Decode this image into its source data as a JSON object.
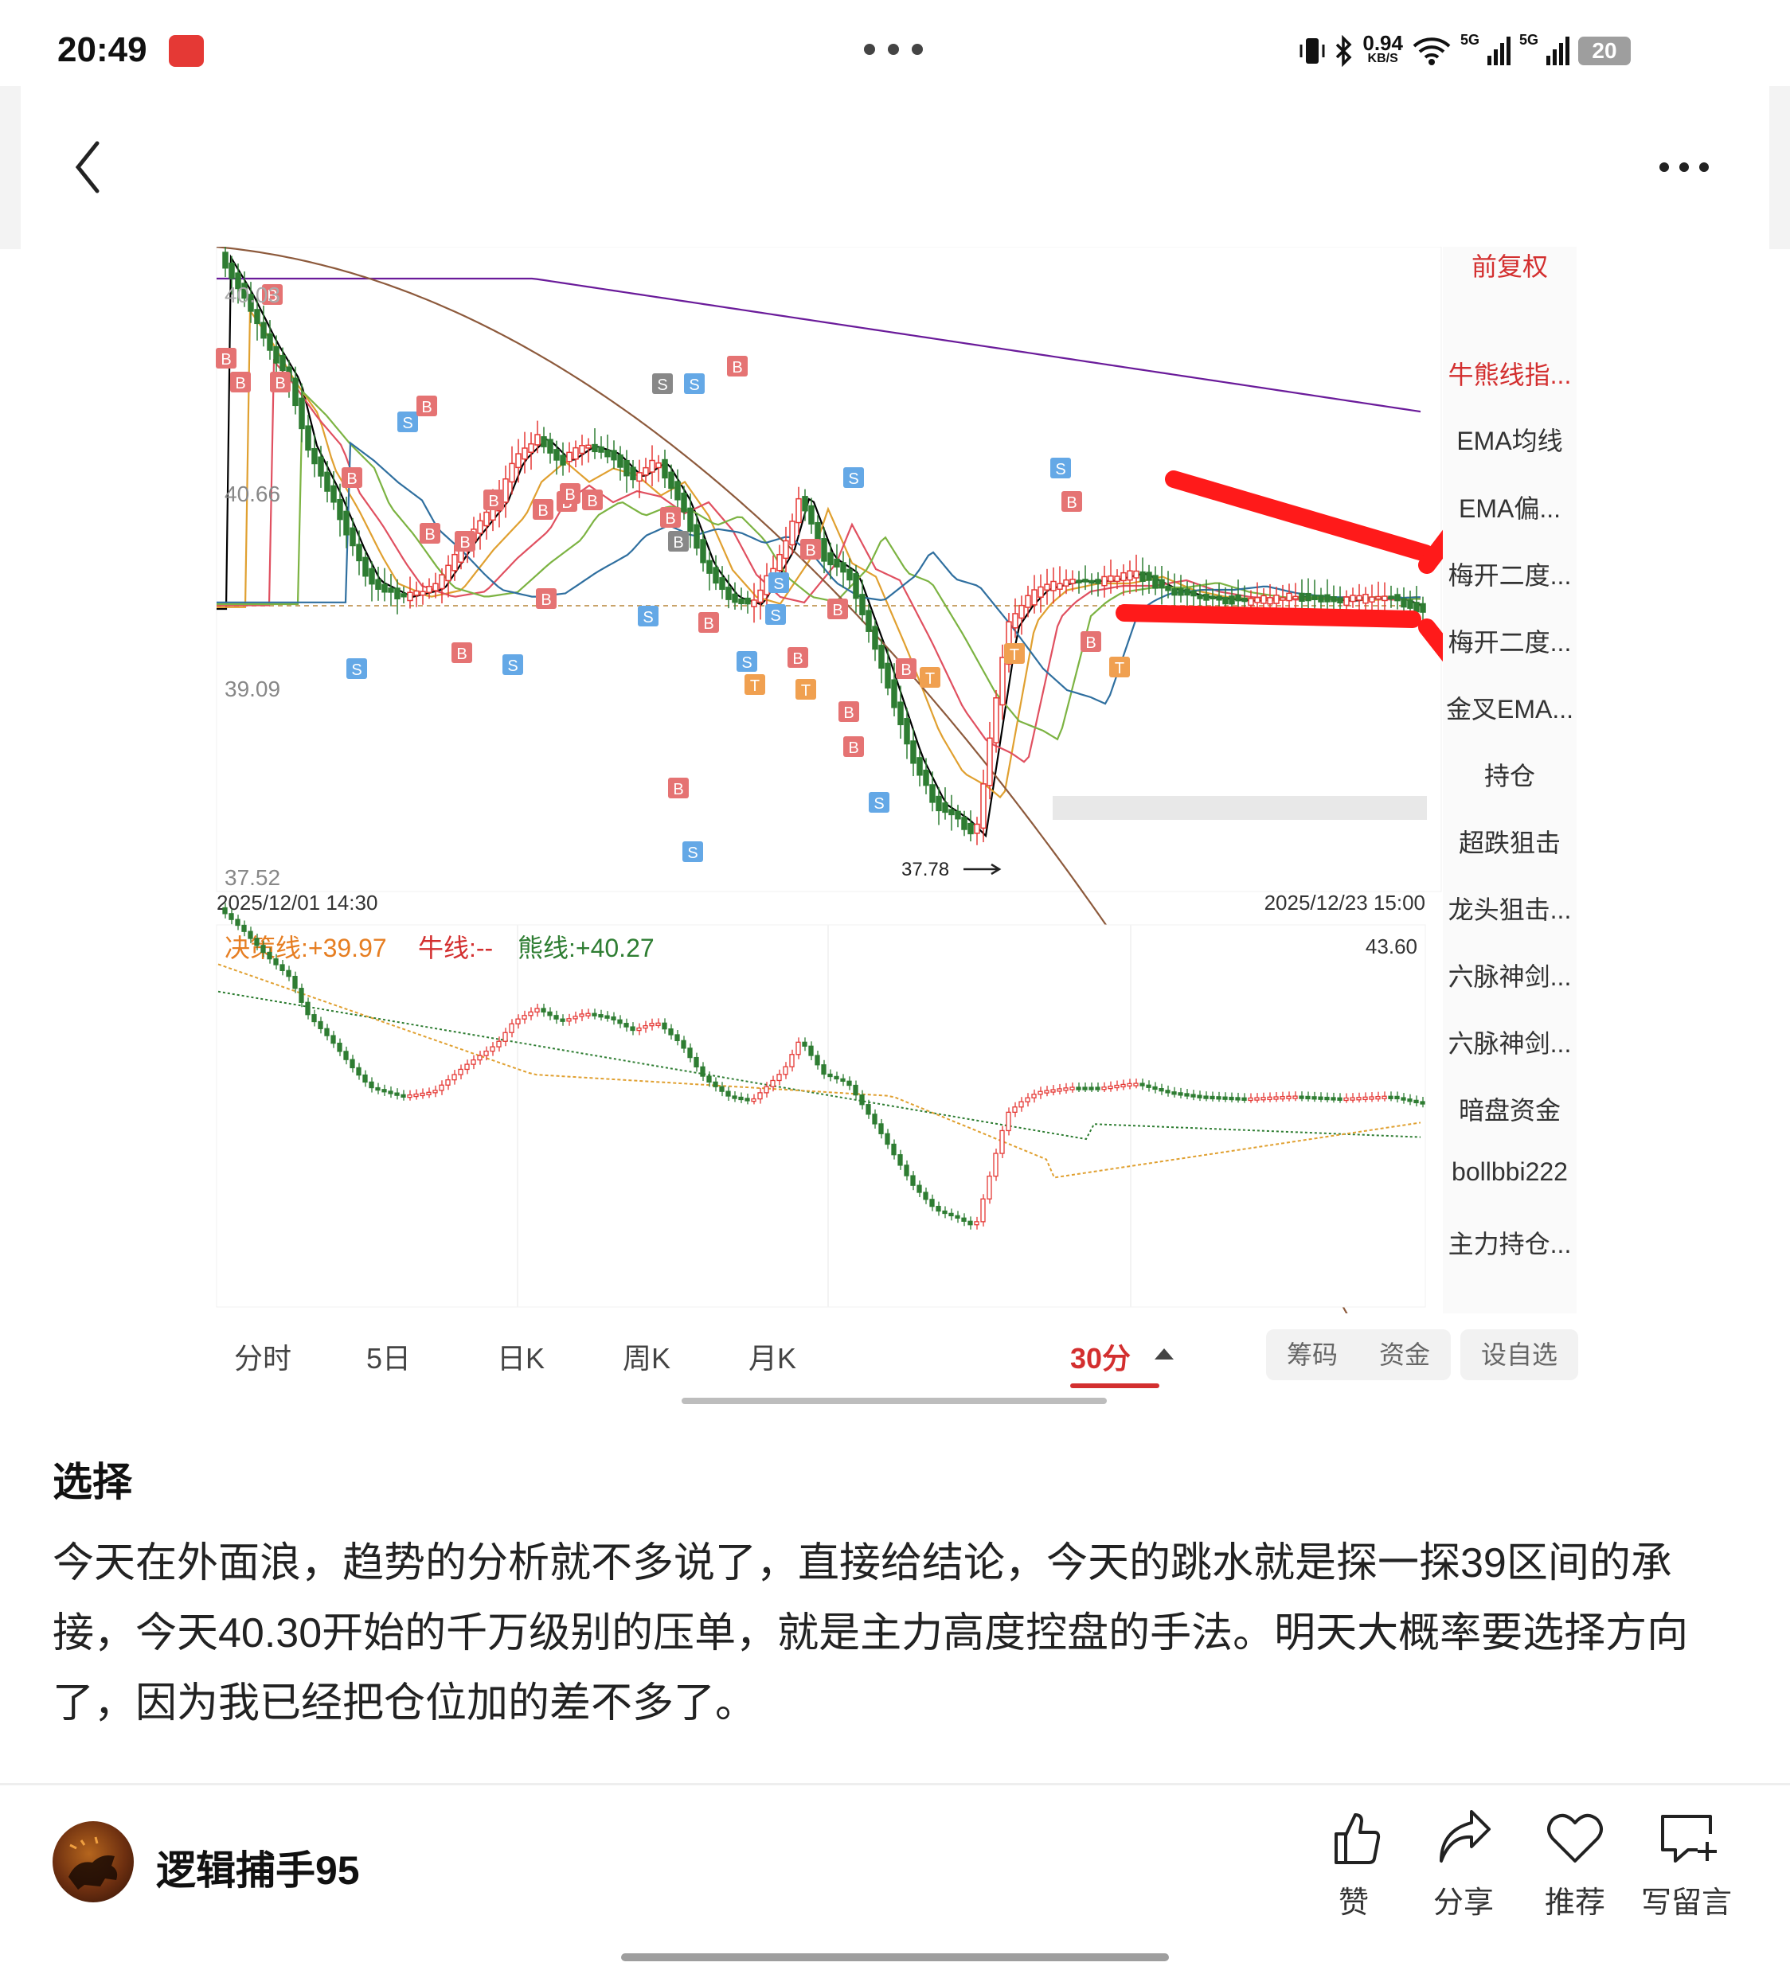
{
  "status_bar": {
    "time": "20:49",
    "network_speed_value": "0.94",
    "network_speed_unit": "KB/S",
    "signal1": "5G",
    "signal2": "5G",
    "battery": "20"
  },
  "chart": {
    "price_labels": [
      "40.03",
      "40.66",
      "39.09",
      "37.52"
    ],
    "min_marker": "37.78",
    "start_time": "2025/12/01 14:30",
    "end_time": "2025/12/23 15:00",
    "sub_indicator": {
      "decision_line": "决策线:+39.97",
      "bull_line": "牛线:--",
      "bear_line": "熊线:+40.27",
      "max_value": "43.60"
    },
    "signal_letters": {
      "buy": "B",
      "sell": "S",
      "t": "T"
    }
  },
  "side_menu": {
    "items": [
      "前复权",
      "牛熊线指...",
      "EMA均线",
      "EMA偏...",
      "梅开二度...",
      "梅开二度...",
      "金叉EMA...",
      "持仓",
      "超跌狙击",
      "龙头狙击...",
      "六脉神剑...",
      "六脉神剑...",
      "暗盘资金",
      "bollbbi222",
      "主力持仓..."
    ]
  },
  "tabs": {
    "items": [
      "分时",
      "5日",
      "日K",
      "周K",
      "月K",
      "30分"
    ],
    "chip": "筹码",
    "fund": "资金",
    "watchlist": "设自选"
  },
  "article": {
    "title": "选择",
    "body": "今天在外面浪，趋势的分析就不多说了，直接给结论，今天的跳水就是探一探39区间的承接，今天40.30开始的千万级别的压单，就是主力高度控盘的手法。明天大概率要选择方向了，因为我已经把仓位加的差不多了。"
  },
  "footer": {
    "author": "逻辑捕手95",
    "actions": [
      "赞",
      "分享",
      "推荐",
      "写留言"
    ]
  },
  "colors": {
    "up": "#e53935",
    "down": "#2e7d32",
    "accent": "#d32f2f",
    "annotation": "#ff0000"
  }
}
